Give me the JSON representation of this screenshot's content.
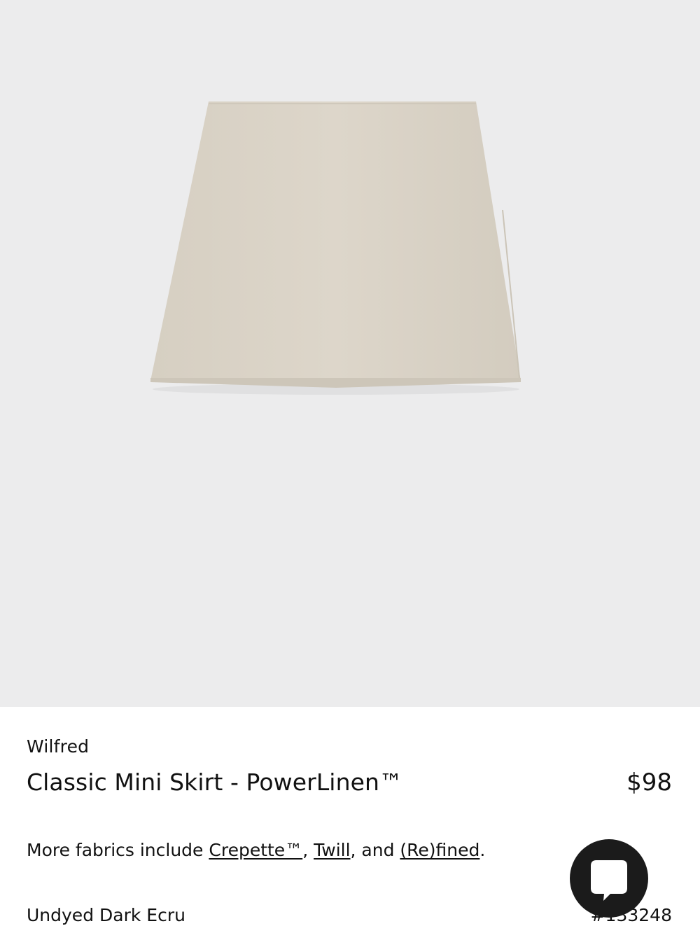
{
  "product": {
    "brand": "Wilfred",
    "title": "Classic Mini Skirt - PowerLinen™",
    "price": "$98",
    "image_icon": "skirt-product-photo",
    "fabric_color": "#ddd6ca"
  },
  "fabrics": {
    "prefix": "More fabrics include ",
    "link1": "Crepette™",
    "sep1": ", ",
    "link2": "Twill",
    "sep2": ", and ",
    "link3": "(Re)fined",
    "suffix": "."
  },
  "variant": {
    "color_name": "Undyed Dark Ecru",
    "style_number": "#133248"
  },
  "chat": {
    "icon": "chat-bubble-icon",
    "background": "#1b1b1b"
  },
  "colors": {
    "image_background": "#ececed",
    "text": "#111111"
  }
}
